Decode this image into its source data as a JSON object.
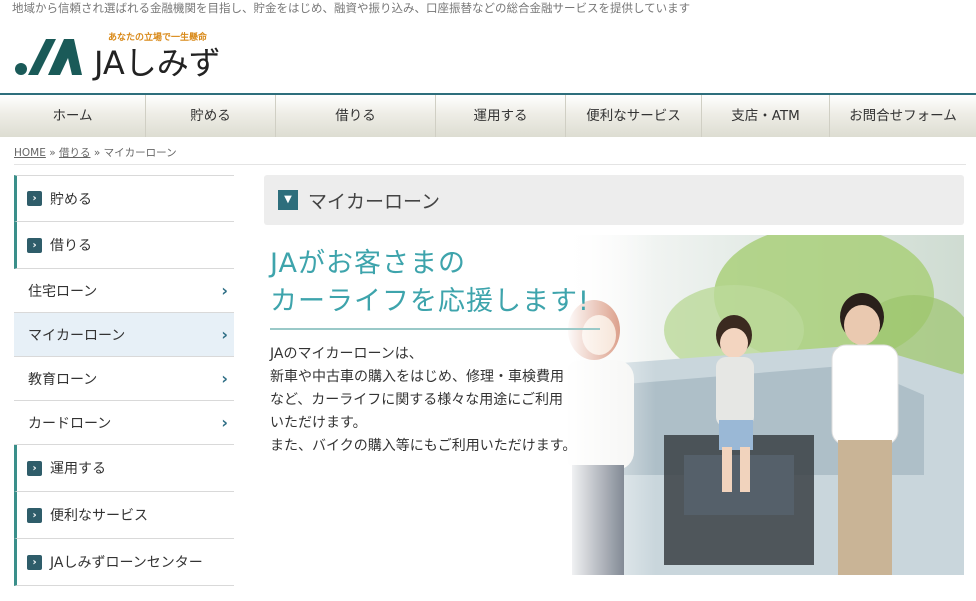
{
  "header": {
    "tagline": "地域から信頼され選ばれる金融機関を目指し、貯金をはじめ、融資や振り込み、口座振替などの総合金融サービスを提供しています",
    "slogan": "あなたの立場で一生懸命",
    "brand": "JAしみず"
  },
  "nav": {
    "items": [
      {
        "label": "ホーム"
      },
      {
        "label": "貯める"
      },
      {
        "label": "借りる"
      },
      {
        "label": "運用する"
      },
      {
        "label": "便利なサービス"
      },
      {
        "label": "支店・ATM"
      },
      {
        "label": "お問合せフォーム"
      }
    ]
  },
  "breadcrumb": {
    "home": "HOME",
    "sep1": "»",
    "parent": "借りる",
    "sep2": "»",
    "current": "マイカーローン"
  },
  "sidebar": {
    "items": [
      {
        "label": "貯める",
        "type": "main"
      },
      {
        "label": "借りる",
        "type": "main"
      },
      {
        "label": "住宅ローン",
        "type": "sub"
      },
      {
        "label": "マイカーローン",
        "type": "sub",
        "active": true
      },
      {
        "label": "教育ローン",
        "type": "sub"
      },
      {
        "label": "カードローン",
        "type": "sub"
      },
      {
        "label": "運用する",
        "type": "main"
      },
      {
        "label": "便利なサービス",
        "type": "main"
      },
      {
        "label": "JAしみずローンセンター",
        "type": "main"
      }
    ]
  },
  "main": {
    "page_title": "マイカーローン",
    "hero": {
      "headline_1": "JAがお客さまの",
      "headline_2": "カーライフを応援します!",
      "body": [
        "JAのマイカーローンは、",
        "新車や中古車の購入をはじめ、修理・車検費用",
        "など、カーライフに関する様々な用途にご利用",
        "いただけます。",
        "また、バイクの購入等にもご利用いただけます。"
      ]
    }
  },
  "colors": {
    "accent": "#2e6e7c",
    "headline": "#3ea4ac",
    "logo_green": "#1a5a58",
    "active_bg": "#e7f0f7"
  },
  "icons": {
    "sidebar_main": "chevron-right-box-icon",
    "sidebar_sub": "chevron-right-icon",
    "page_title": "triangle-down-box-icon"
  }
}
